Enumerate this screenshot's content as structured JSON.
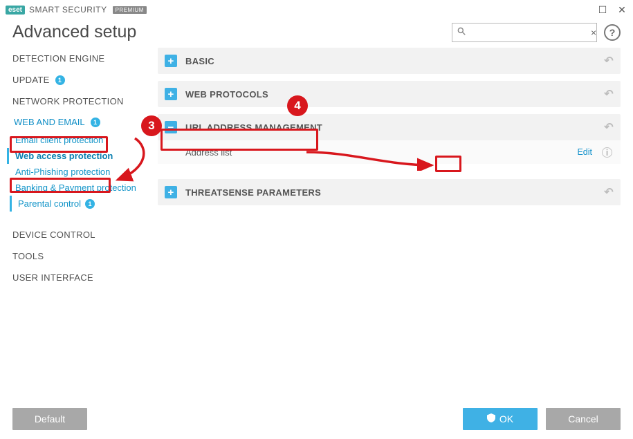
{
  "titlebar": {
    "brand_badge": "eset",
    "brand_text": "SMART SECURITY",
    "brand_premium": "PREMIUM"
  },
  "page_title": "Advanced setup",
  "search": {
    "placeholder": "",
    "clear": "×"
  },
  "help_label": "?",
  "sidebar": {
    "detection": "DETECTION ENGINE",
    "update": "UPDATE",
    "update_badge": "1",
    "netprot": "NETWORK PROTECTION",
    "webemail": "WEB AND EMAIL",
    "webemail_badge": "1",
    "sub_email_client": "Email client protection",
    "sub_web_access": "Web access protection",
    "sub_antiphish": "Anti-Phishing protection",
    "sub_banking": "Banking & Payment protection",
    "sub_parental": "Parental control",
    "parental_badge": "1",
    "device": "DEVICE CONTROL",
    "tools": "TOOLS",
    "ui": "USER INTERFACE"
  },
  "sections": {
    "basic": "BASIC",
    "web_protocols": "WEB PROTOCOLS",
    "url_mgmt": "URL ADDRESS MANAGEMENT",
    "threatsense": "THREATSENSE PARAMETERS",
    "address_list_label": "Address list",
    "edit": "Edit"
  },
  "footer": {
    "default": "Default",
    "ok": "OK",
    "cancel": "Cancel"
  },
  "annotations": {
    "step3": "3",
    "step4": "4"
  }
}
